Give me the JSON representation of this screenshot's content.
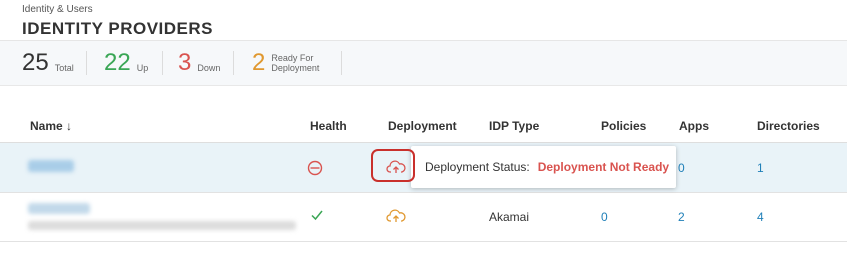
{
  "header": {
    "breadcrumb": "Identity & Users",
    "title": "IDENTITY PROVIDERS"
  },
  "stats": [
    {
      "value": "25",
      "label": "Total",
      "color": "#333333"
    },
    {
      "value": "22",
      "label": "Up",
      "color": "#3aa655"
    },
    {
      "value": "3",
      "label": "Down",
      "color": "#d9534f"
    },
    {
      "value": "2",
      "label": "Ready For Deployment",
      "color": "#e0982f"
    }
  ],
  "table": {
    "columns": [
      "Name ↓",
      "Health",
      "Deployment",
      "IDP Type",
      "Policies",
      "Apps",
      "Directories"
    ],
    "rows": [
      {
        "health": "down-icon",
        "deployment": "cloud-upload-icon",
        "idp_type": "",
        "policies": "",
        "apps": "0",
        "directories": "1"
      },
      {
        "health": "check-icon",
        "deployment": "cloud-upload-icon",
        "idp_type": "Akamai",
        "policies": "0",
        "apps": "2",
        "directories": "4"
      }
    ]
  },
  "tooltip": {
    "label": "Deployment Status:",
    "value": "Deployment Not Ready"
  },
  "colors": {
    "link": "#1f7fb8",
    "error": "#d9534f",
    "success": "#3aa655",
    "warning": "#e0982f"
  }
}
